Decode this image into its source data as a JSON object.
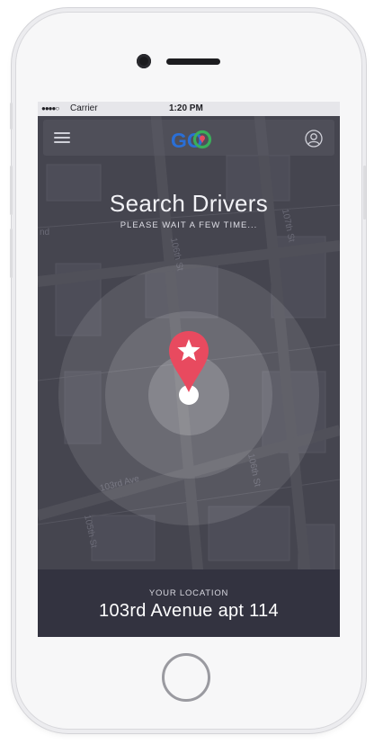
{
  "status_bar": {
    "signal": "●●●●○",
    "carrier": "Carrier",
    "time": "1:20 PM"
  },
  "header": {
    "logo_text": "GO",
    "menu_icon": "hamburger-menu-icon",
    "profile_icon": "user-profile-icon"
  },
  "search": {
    "title": "Search Drivers",
    "subtitle": "PLEASE WAIT A FEW TIME..."
  },
  "map": {
    "street_labels": [
      "107th St",
      "106th St",
      "103rd Ave",
      "106th St",
      "105th St",
      "nd"
    ]
  },
  "location": {
    "label": "YOUR LOCATION",
    "value": "103rd Avenue apt 114"
  },
  "colors": {
    "pin": "#e84a5f",
    "overlay": "#44444f",
    "panel": "#333340",
    "logo_blue": "#2a6fd6",
    "logo_green": "#3aae5a"
  }
}
